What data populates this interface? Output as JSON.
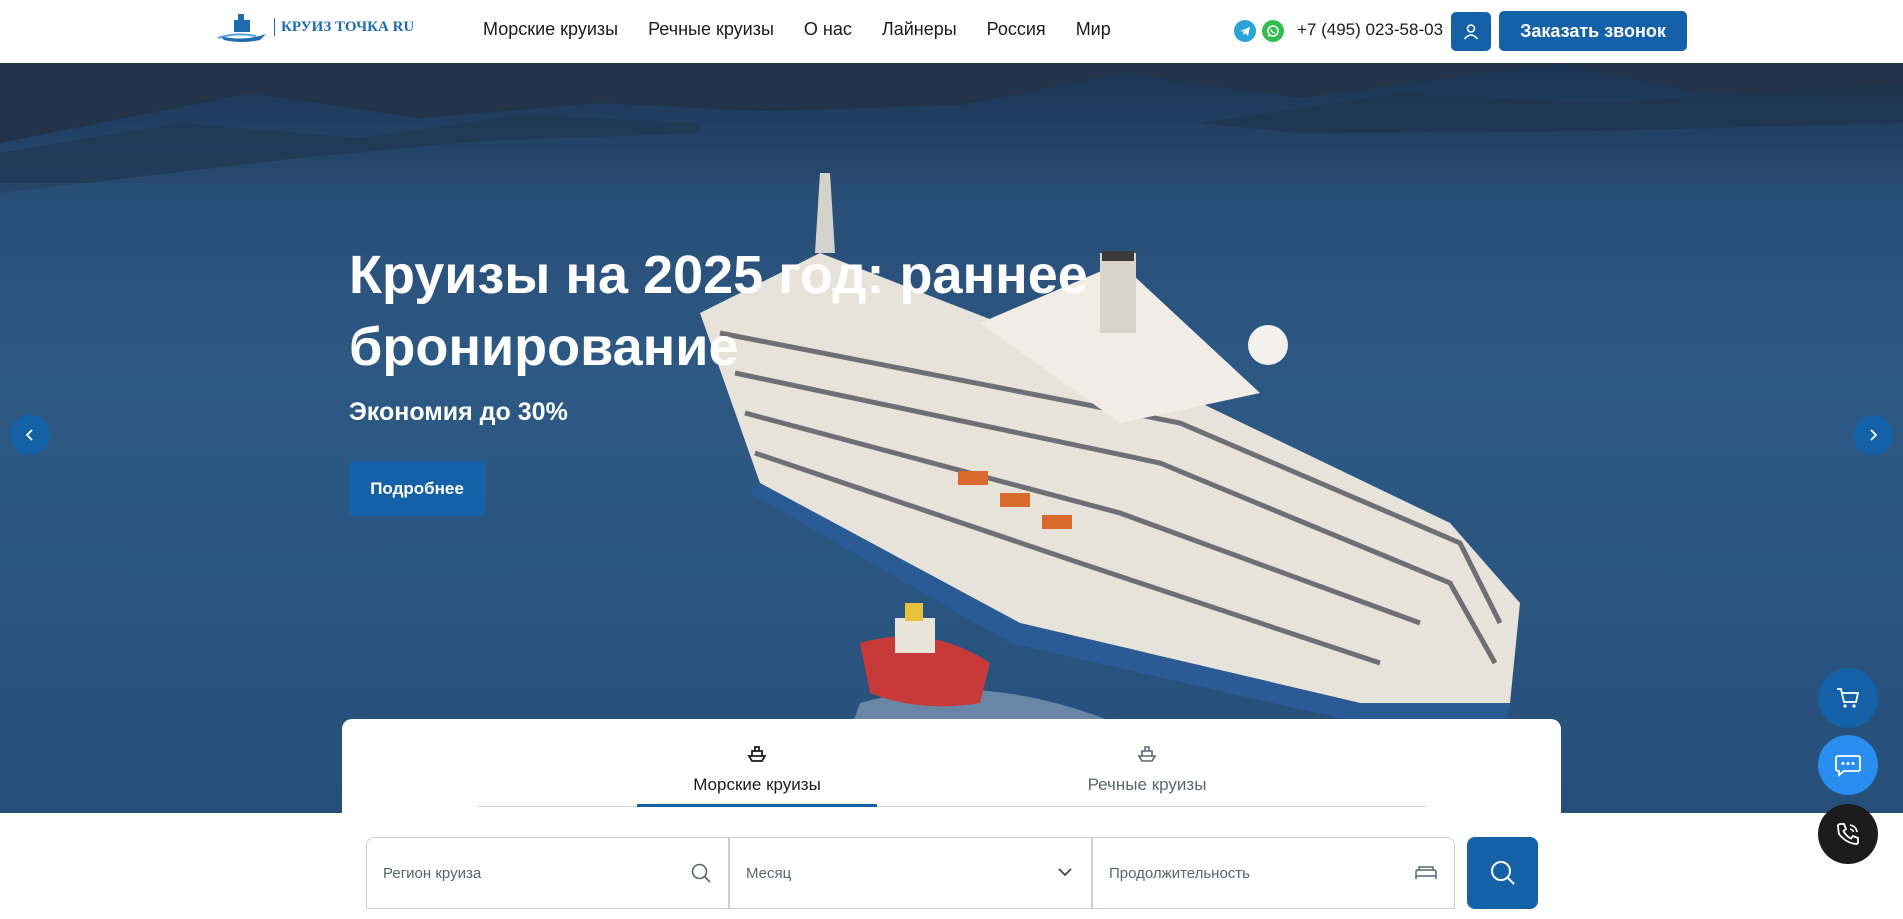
{
  "header": {
    "logo_text": "КРУИЗ ТОЧКА RU",
    "nav": [
      "Морские круизы",
      "Речные круизы",
      "О нас",
      "Лайнеры",
      "Россия",
      "Мир"
    ],
    "phone": "+7 (495) 023-58-03",
    "callback_label": "Заказать звонок"
  },
  "hero": {
    "title": "Круизы на 2025 год: раннее бронирование",
    "subtitle": "Экономия до 30%",
    "button_label": "Подробнее"
  },
  "search": {
    "tabs": [
      {
        "label": "Морские круизы",
        "active": true
      },
      {
        "label": "Речные круизы",
        "active": false
      }
    ],
    "region_placeholder": "Регион круиза",
    "month_placeholder": "Месяц",
    "duration_placeholder": "Продолжительность"
  },
  "colors": {
    "primary": "#1461a8",
    "chat": "#2a8ef0",
    "telegram": "#2aa3d9",
    "whatsapp": "#2fbe4f"
  },
  "icons": [
    "telegram-icon",
    "whatsapp-icon",
    "user-icon",
    "chevron-left-icon",
    "chevron-right-icon",
    "ship-icon",
    "search-icon",
    "chevron-down-icon",
    "bed-icon",
    "cart-icon",
    "chat-icon",
    "phone-icon"
  ]
}
